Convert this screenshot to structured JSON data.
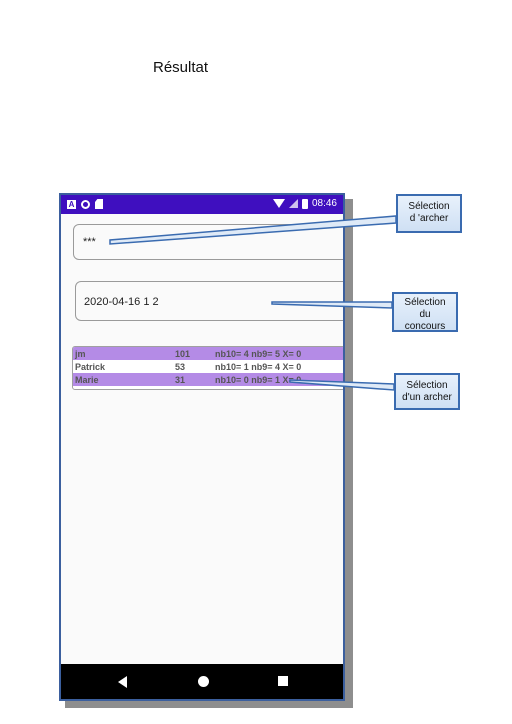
{
  "document": {
    "title": "Résultat"
  },
  "status_bar": {
    "time": "08:46",
    "app_icon_letter": "A"
  },
  "archer_field": {
    "value": "***"
  },
  "contest_field": {
    "value": "2020-04-16 1 2"
  },
  "results_list": [
    {
      "name": "jm",
      "score": "101",
      "details": "nb10= 4 nb9= 5 X= 0",
      "highlighted": true
    },
    {
      "name": "Patrick",
      "score": "53",
      "details": "nb10= 1 nb9= 4 X= 0",
      "highlighted": false
    },
    {
      "name": "Marie",
      "score": "31",
      "details": "nb10= 0 nb9= 1 X= 0",
      "highlighted": true
    }
  ],
  "callouts": {
    "archer_line1": "Sélection",
    "archer_line2": "d 'archer",
    "contest_line1": "Sélection",
    "contest_line2": "du",
    "contest_line3": "concours",
    "row_line1": "Sélection",
    "row_line2": "d'un archer"
  },
  "colors": {
    "status_bar": "#3f0fbf",
    "highlight": "#b48be6",
    "callout_border": "#3a6bb0"
  }
}
